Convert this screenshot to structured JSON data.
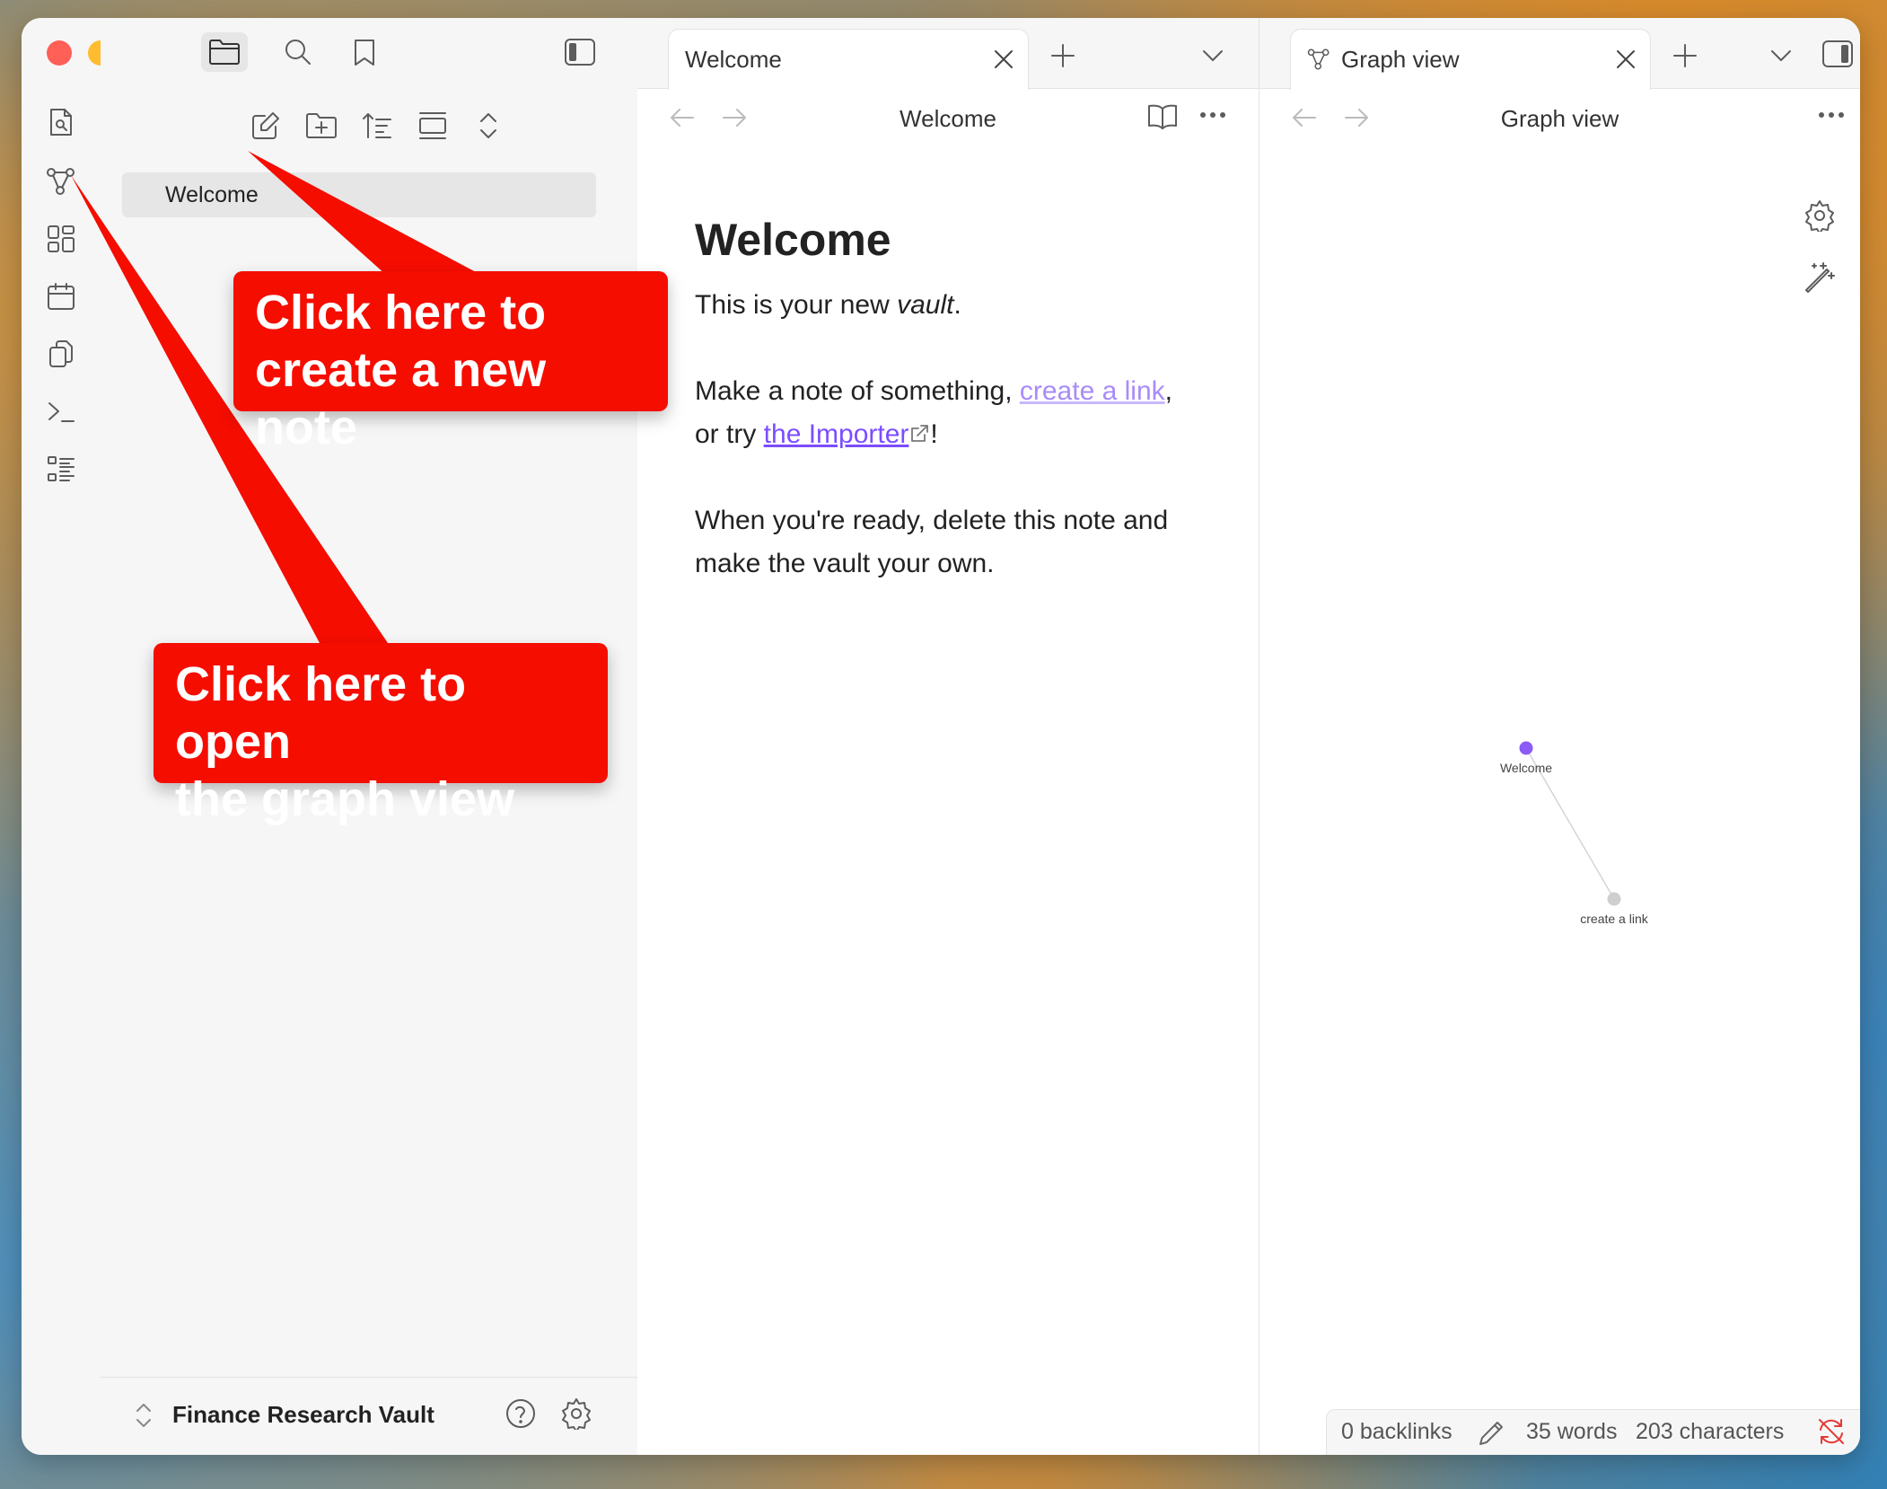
{
  "sidebar": {
    "file_items": [
      {
        "label": "Welcome"
      }
    ],
    "vault_name": "Finance Research Vault"
  },
  "pane_left": {
    "tab_label": "Welcome",
    "view_title": "Welcome",
    "note": {
      "heading": "Welcome",
      "p1_prefix": "This is your new ",
      "p1_em": "vault",
      "p1_suffix": ".",
      "p2_prefix": "Make a note of something, ",
      "p2_link_internal": "create a link",
      "p2_middle": ", or try ",
      "p2_link_external": "the Importer",
      "p2_suffix": "!",
      "p3": "When you're ready, delete this note and make the vault your own."
    }
  },
  "pane_right": {
    "tab_label": "Graph view",
    "view_title": "Graph view",
    "graph": {
      "nodes": [
        {
          "label": "Welcome",
          "color": "#8b5cf6"
        },
        {
          "label": "create a link",
          "color": "#cfcfcf"
        }
      ]
    }
  },
  "status_bar": {
    "backlinks": "0 backlinks",
    "words": "35 words",
    "characters": "203 characters"
  },
  "callouts": {
    "new_note": {
      "line1": "Click here to",
      "line2": "create a new note"
    },
    "graph_view": {
      "line1": "Click here to open",
      "line2": "the graph view"
    }
  },
  "colors": {
    "accent": "#7c4dff",
    "callout": "#f50d00"
  }
}
